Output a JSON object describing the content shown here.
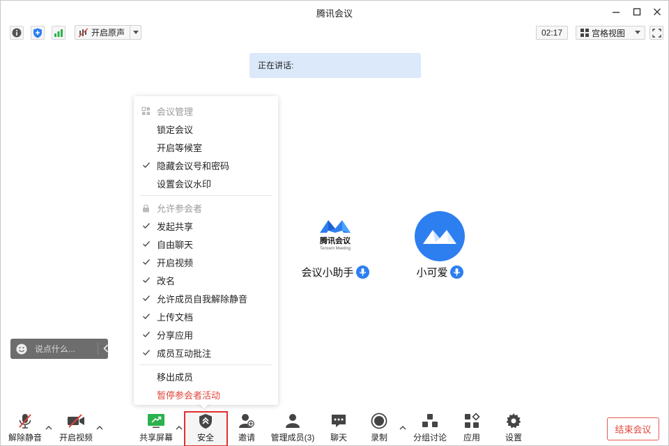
{
  "window": {
    "title": "腾讯会议"
  },
  "toolbar": {
    "original_sound_label": "开启原声",
    "timer": "02:17",
    "view_label": "宫格视图"
  },
  "speaking_banner": "正在讲话:",
  "participants": [
    {
      "name": "会议小助手",
      "logo_text": "腾讯会议",
      "logo_sub": "Tencent Meeting"
    },
    {
      "name": "小可爱"
    }
  ],
  "chat_input": {
    "placeholder": "说点什么..."
  },
  "security_menu": {
    "section_meeting": "会议管理",
    "meeting_items": [
      {
        "label": "锁定会议",
        "checked": false
      },
      {
        "label": "开启等候室",
        "checked": false
      },
      {
        "label": "隐藏会议号和密码",
        "checked": true
      },
      {
        "label": "设置会议水印",
        "checked": false
      }
    ],
    "section_allow": "允许参会者",
    "allow_items": [
      {
        "label": "发起共享",
        "checked": true
      },
      {
        "label": "自由聊天",
        "checked": true
      },
      {
        "label": "开启视频",
        "checked": true
      },
      {
        "label": "改名",
        "checked": true
      },
      {
        "label": "允许成员自我解除静音",
        "checked": true
      },
      {
        "label": "上传文档",
        "checked": true
      },
      {
        "label": "分享应用",
        "checked": true
      },
      {
        "label": "成员互动批注",
        "checked": true
      }
    ],
    "remove_member": "移出成员",
    "pause_activity": "暂停参会者活动"
  },
  "bottom_bar": {
    "unmute": "解除静音",
    "start_video": "开启视频",
    "share_screen": "共享屏幕",
    "security": "安全",
    "invite": "邀请",
    "manage_members": "管理成员(3)",
    "chat": "聊天",
    "record": "录制",
    "breakout": "分组讨论",
    "apps": "应用",
    "settings": "设置",
    "end_meeting": "结束会议"
  },
  "colors": {
    "accent": "#2d7ff0",
    "danger": "#e0453a",
    "share_green": "#2bb24c",
    "highlight_border": "#e02f2f"
  }
}
